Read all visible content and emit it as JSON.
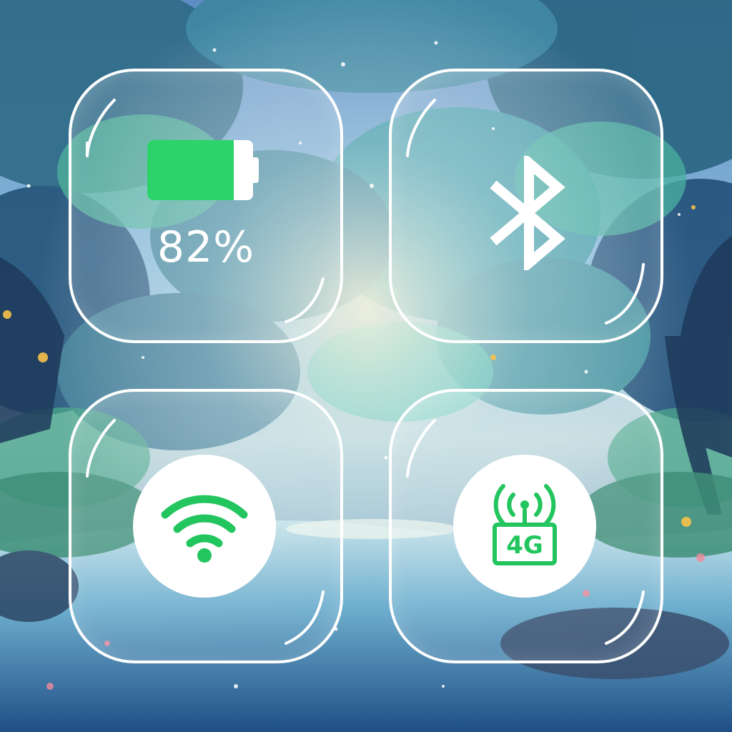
{
  "widgets": {
    "battery": {
      "percent_label": "82%",
      "level": 0.82,
      "icon": "battery-icon",
      "fill_color": "#2cd36a"
    },
    "bluetooth": {
      "icon": "bluetooth-icon"
    },
    "wifi": {
      "icon": "wifi-icon",
      "icon_color": "#22c55e"
    },
    "cellular": {
      "icon": "cellular-4g-icon",
      "network_label": "4G",
      "icon_color": "#22c55e"
    }
  },
  "theme": {
    "accent": "#22c55e",
    "tile_border": "#ffffff"
  }
}
